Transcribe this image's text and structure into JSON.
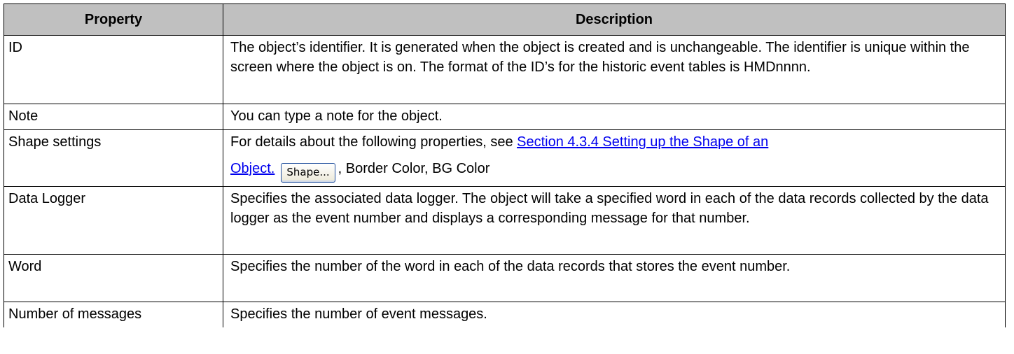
{
  "table": {
    "headers": {
      "property": "Property",
      "description": "Description"
    },
    "rows": {
      "id": {
        "property": "ID",
        "description": "The object’s identifier. It is generated when the object is created and is unchangeable. The identifier is unique within the screen where the object is on. The format of the ID’s for the historic event tables is HMDnnnn."
      },
      "note": {
        "property": "Note",
        "description": "You can type a note for the object."
      },
      "shape": {
        "property": "Shape settings",
        "description_prefix": "For details about the following properties, see ",
        "link_text_1": "Section 4.3.4 Setting up the Shape of an",
        "link_text_2": "Object.",
        "button_label": "Shape...",
        "description_suffix": ", Border Color, BG Color"
      },
      "data_logger": {
        "property": "Data Logger",
        "description": "Specifies the associated data logger. The object will take a specified word in each of the data records collected by the data logger as the event number and displays a corresponding message for that number."
      },
      "word": {
        "property": "Word",
        "description": "Specifies the number of the word in each of the data records that stores the event number."
      },
      "number_of_messages": {
        "property": "Number of messages",
        "description": "Specifies the number of event messages."
      }
    }
  },
  "colors": {
    "header_background": "#c0c0c0",
    "link": "#0000ee",
    "border": "#000000"
  }
}
